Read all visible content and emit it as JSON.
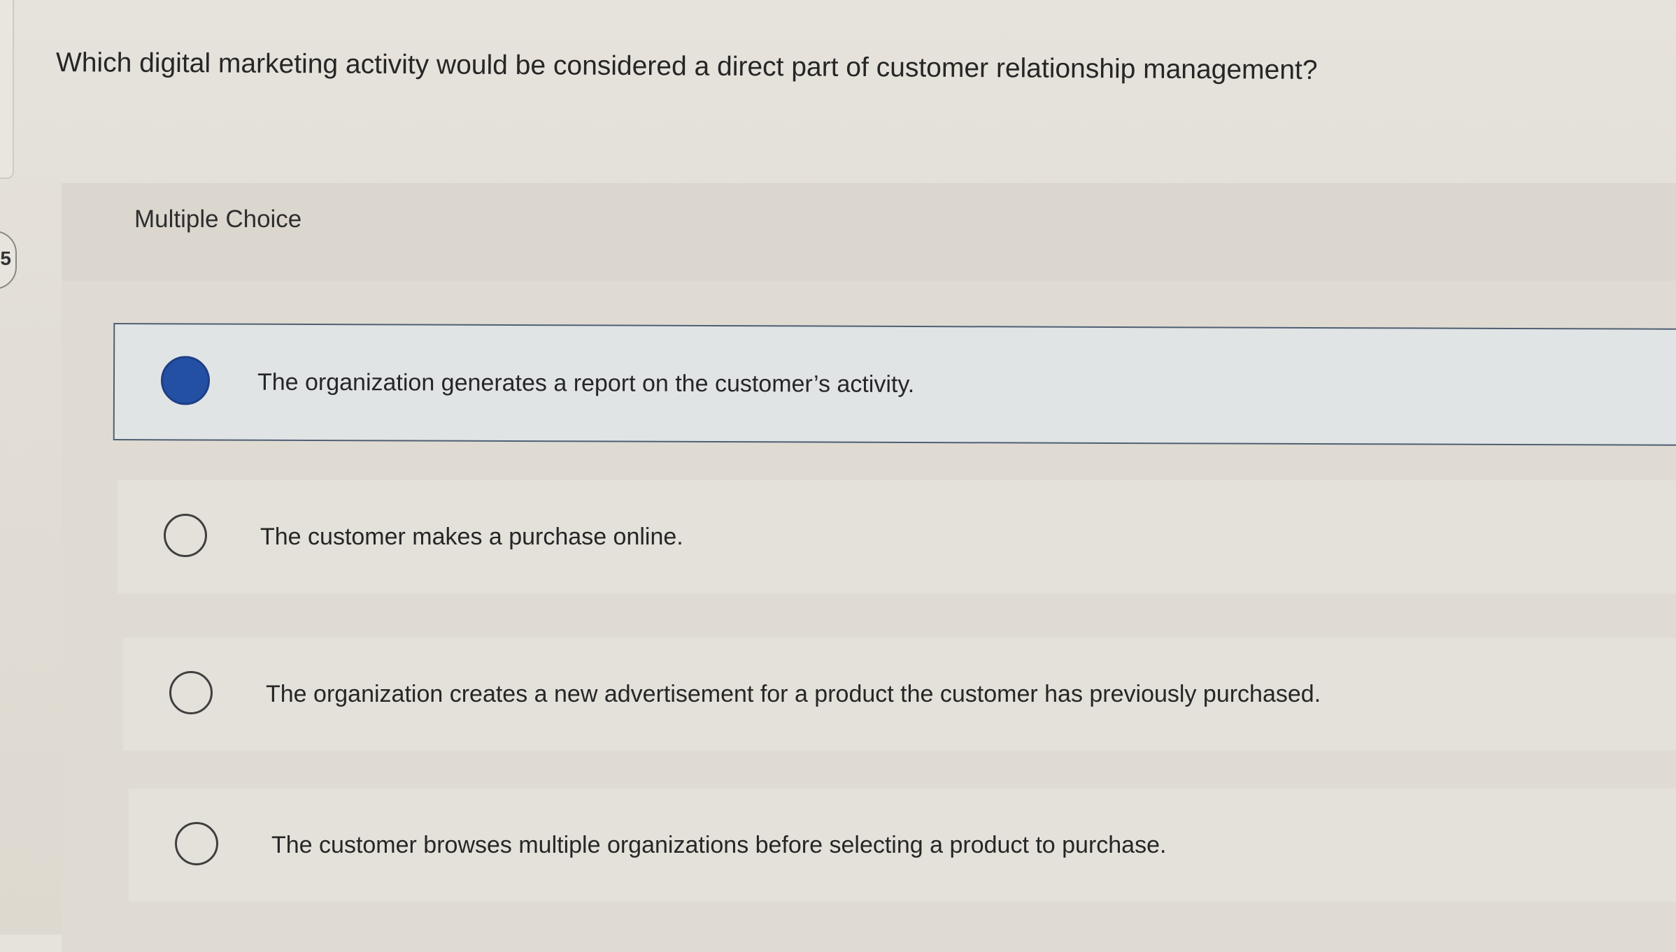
{
  "question": {
    "text": "Which digital marketing activity would be considered a direct part of customer relationship management?"
  },
  "side_badge": {
    "text": "5"
  },
  "answer_panel": {
    "label": "Multiple Choice",
    "options": [
      {
        "text": "The organization generates a report on the customer’s activity.",
        "selected": true
      },
      {
        "text": "The customer makes a purchase online.",
        "selected": false
      },
      {
        "text": "The organization creates a new advertisement for a product the customer has previously purchased.",
        "selected": false
      },
      {
        "text": "The customer browses multiple organizations before selecting a product to purchase.",
        "selected": false
      }
    ]
  },
  "colors": {
    "selected_radio": "#2450a3",
    "selected_border": "#4f5f72",
    "background": "#e2ded6"
  }
}
